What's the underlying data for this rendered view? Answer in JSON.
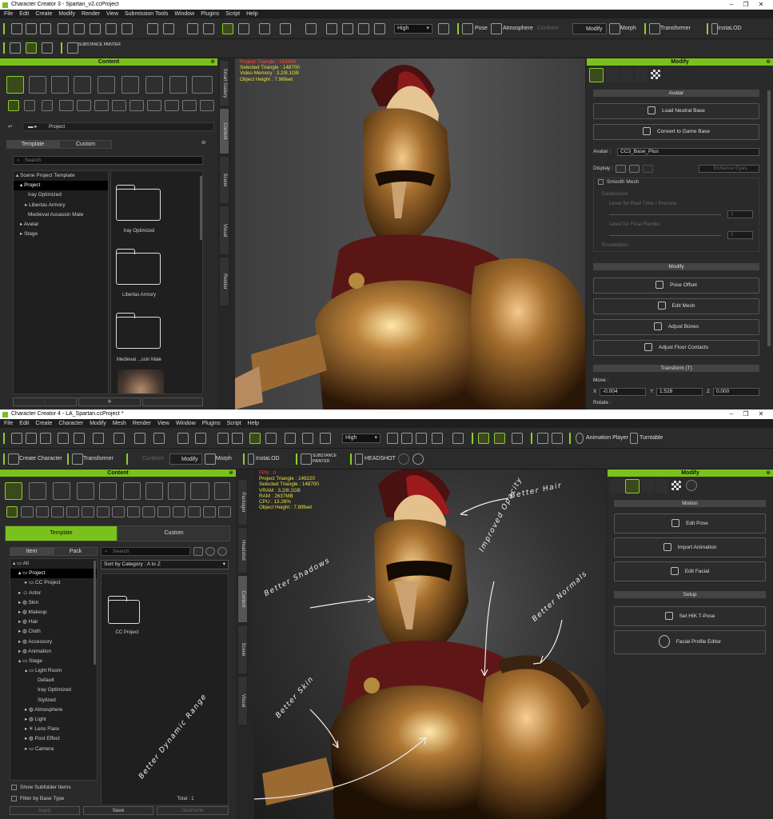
{
  "colors": {
    "accent": "#7ac21b",
    "hud": "#e8e040"
  },
  "cc3": {
    "title": "Character Creator 3 - Spartan_v2.ccProject",
    "menu": [
      "File",
      "Edit",
      "Create",
      "Modify",
      "Render",
      "View",
      "Submission Tools",
      "Window",
      "Plugins",
      "Script",
      "Help"
    ],
    "toolbar": {
      "quality": "High",
      "pose": "Pose",
      "atmosphere": "Atmosphere",
      "conform": "Conform",
      "modify": "Modify",
      "morph": "Morph",
      "transformer": "Transformer",
      "instalod": "InstaLOD",
      "substance": "SUBSTANCE PAINTER"
    },
    "content": {
      "title": "Content",
      "breadcrumb": "Project",
      "tabs": [
        "Template",
        "Custom"
      ],
      "search": "Search",
      "tree": [
        "Scene Project Template",
        "Project",
        "Iray Optimized",
        "Libertas Armory",
        "Medieval Assassin Male",
        "Avatar",
        "Stage"
      ],
      "thumbs": [
        "Iray Optimized",
        "Libertas Armory",
        "Medieval ...ssin Male"
      ],
      "sidetabs": [
        "Smart Gallery",
        "Content",
        "Scene",
        "Visual",
        "Render"
      ]
    },
    "hud": {
      "l1": "Project Triangle : 153898",
      "l2": "Selected Triangle : 148700",
      "l3": "Video Memory : 3.2/8.1GB",
      "l4": "Object Height : 7.96feet"
    },
    "modify": {
      "title": "Modify",
      "avatar_section": "Avatar",
      "load_neutral": "Load Neutral Base",
      "convert_game": "Convert to Game Base",
      "avatar_label": "Avatar :",
      "avatar_value": "CC3_Base_Plus",
      "display_label": "Display :",
      "enhance_eyes": "Enhance Eyes",
      "smooth_mesh": "Smooth Mesh",
      "subdivision": "Subdivision",
      "level_realtime": "Level for Real Time / Preview",
      "level_final": "Level for Final Render",
      "tessellation": "Tessellation",
      "level_val": "1",
      "modify_section": "Modify",
      "pose_offset": "Pose Offset",
      "edit_mesh": "Edit Mesh",
      "adjust_bones": "Adjust Bones",
      "adjust_floor": "Adjust Floor Contacts",
      "transform_section": "Transform (T)",
      "move": "Move :",
      "x": "X",
      "y": "Y",
      "z": "Z",
      "xv": "-0.004",
      "yv": "1.528",
      "zv": "0.000",
      "rotate": "Rotate :"
    }
  },
  "cc4": {
    "title": "Character Creator 4 - LA_Spartan.ccProject *",
    "menu": [
      "File",
      "Edit",
      "Create",
      "Character",
      "Modify",
      "Mesh",
      "Render",
      "View",
      "Window",
      "Plugins",
      "Script",
      "Help"
    ],
    "toolbar": {
      "quality": "High",
      "animation_player": "Animation Player",
      "turntable": "Turntable",
      "create_character": "Create Character",
      "transformer": "Transformer",
      "conform": "Conform",
      "modify": "Modify",
      "morph": "Morph",
      "instalod": "InstaLOD",
      "substance": "SUBSTANCE PAINTER",
      "headshot": "HEADSHOT"
    },
    "content": {
      "title": "Content",
      "tabs": [
        "Template",
        "Custom"
      ],
      "subtabs": [
        "Item",
        "Pack"
      ],
      "search": "Search",
      "sort": "Sort by Category : A to Z",
      "tree": [
        "All",
        "Project",
        "CC Project",
        "Actor",
        "Skin",
        "Makeup",
        "Hair",
        "Cloth",
        "Accessory",
        "Animation",
        "Stage",
        "Light Room",
        "Default",
        "Iray Optimized",
        "Stylized",
        "Atmosphere",
        "Light",
        "Lens Flare",
        "Post Effect",
        "Camera"
      ],
      "thumb": "CC Project",
      "show_subfolder": "Show Subfolder Items",
      "filter_base": "Filter by Base Type",
      "total": "Total : 1",
      "apply": "Apply",
      "save": "Save",
      "overwrite": "Overwrite",
      "sidetabs": [
        "Packager",
        "Headshot",
        "Content",
        "Scene",
        "Visual"
      ]
    },
    "hud": {
      "fps": "FPS : 0",
      "l1": "Project Triangle : 149220",
      "l2": "Selected Triangle : 148700",
      "l3": "VRAM : 3.2/8.1GB",
      "l4": "RAM : 2637MB",
      "l5": "CPU : 13.26%",
      "l6": "Object Height : 7.89feet"
    },
    "notes": {
      "hair": "Better Hair",
      "opacity": "Improved Opacity",
      "normals": "Better Normals",
      "shadows": "Better Shadows",
      "skin": "Better Skin",
      "dynamic": "Better Dynamic Range"
    },
    "modify": {
      "title": "Modify",
      "motion_section": "Motion",
      "edit_pose": "Edit Pose",
      "import_animation": "Import Animation",
      "edit_facial": "Edit Facial",
      "setup_section": "Setup",
      "set_hik": "Set HIK T-Pose",
      "facial_profile": "Facial Profile Editor"
    }
  }
}
